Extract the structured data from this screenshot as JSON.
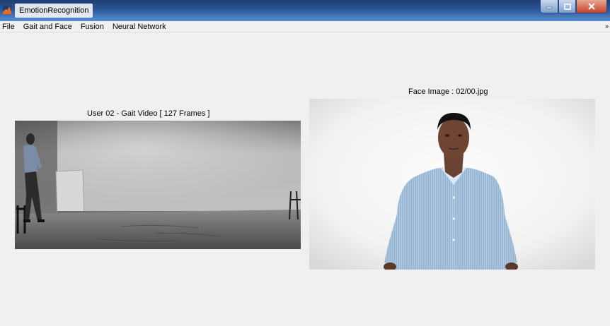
{
  "window": {
    "title": "EmotionRecognition",
    "icon": "matlab-icon",
    "controls": [
      "minimize-icon",
      "maximize-icon",
      "close-icon"
    ]
  },
  "menu": {
    "items": [
      "File",
      "Gait and Face",
      "Fusion",
      "Neural Network"
    ],
    "overflow": "»"
  },
  "gait": {
    "title": "User 02 - Gait Video [ 127 Frames ]"
  },
  "face": {
    "title": "Face Image : 02/00.jpg"
  },
  "colors": {
    "titlebar": "#2b5797",
    "background": "#f0f0f0",
    "close_button": "#c7442a"
  }
}
